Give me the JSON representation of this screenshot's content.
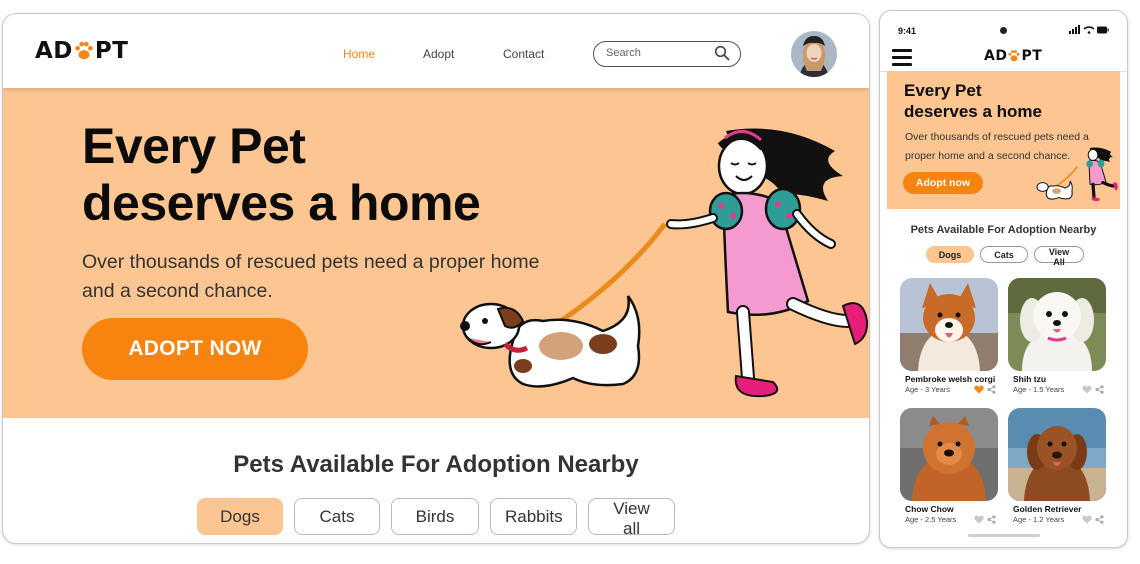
{
  "brand": {
    "logo_prefix": "AD",
    "logo_suffix": "PT",
    "accent": "#f7871b",
    "hero_bg": "#fcc591"
  },
  "desktop": {
    "nav": {
      "links": [
        "Home",
        "Adopt",
        "Contact"
      ],
      "active": "Home"
    },
    "search": {
      "placeholder": "Search"
    },
    "hero": {
      "title_line1": "Every Pet",
      "title_line2": "deserves a home",
      "subtitle": "Over thousands of rescued pets need a proper home and a second chance.",
      "cta": "ADOPT NOW"
    },
    "section_title": "Pets Available For Adoption Nearby",
    "chips": [
      "Dogs",
      "Cats",
      "Birds",
      "Rabbits",
      "View all"
    ],
    "active_chip": "Dogs"
  },
  "mobile": {
    "status": {
      "time": "9:41"
    },
    "hero": {
      "title_line1": "Every Pet",
      "title_line2": "deserves a home",
      "subtitle": "Over thousands of rescued pets need a proper home  and a second chance.",
      "cta": "Adopt now"
    },
    "section_title": "Pets Available For Adoption Nearby",
    "chips": [
      "Dogs",
      "Cats",
      "View All"
    ],
    "active_chip": "Dogs",
    "pets": [
      {
        "name": "Pembroke welsh corgi",
        "age": "Age - 3 Years",
        "favorited": true
      },
      {
        "name": "Shih tzu",
        "age": "Age - 1.5 Years",
        "favorited": false
      },
      {
        "name": "Chow Chow",
        "age": "Age - 2.5 Years",
        "favorited": false
      },
      {
        "name": "Golden Retriever",
        "age": "Age - 1.2 Years",
        "favorited": false
      }
    ]
  }
}
